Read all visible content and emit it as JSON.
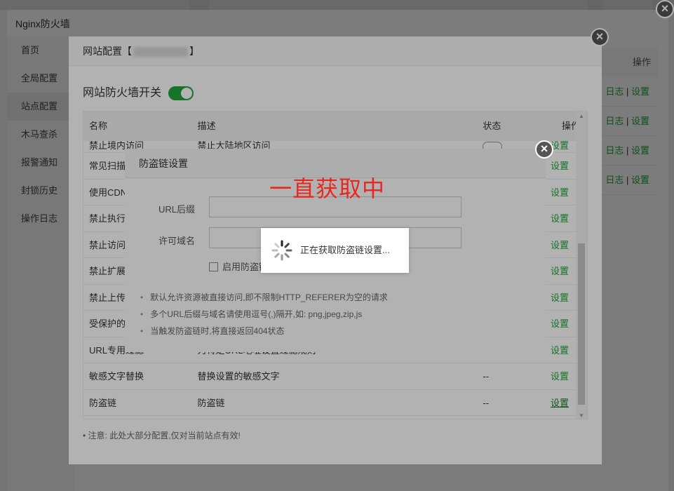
{
  "app": {
    "window_title": "Nginx防火墙"
  },
  "sidebar": {
    "items": [
      {
        "label": "首页"
      },
      {
        "label": "全局配置"
      },
      {
        "label": "站点配置"
      },
      {
        "label": "木马查杀"
      },
      {
        "label": "报警通知"
      },
      {
        "label": "封锁历史"
      },
      {
        "label": "操作日志"
      }
    ]
  },
  "bg_table": {
    "header": "操作",
    "row_links": {
      "log": "日志",
      "sep": "|",
      "set": "设置"
    }
  },
  "site_modal": {
    "title_prefix": "网站配置【",
    "title_suffix": "】",
    "toggle_label": "网站防火墙开关",
    "toggle_on": true,
    "columns": {
      "name": "名称",
      "desc": "描述",
      "status": "状态",
      "op": "操作"
    },
    "rows": [
      {
        "name": "禁止境内访问",
        "desc": "禁止大陆地区访问",
        "status": "",
        "op": "设置"
      },
      {
        "name": "常见扫描",
        "desc": "",
        "status": "",
        "op": "设置"
      },
      {
        "name": "使用CDN",
        "desc": "",
        "status": "",
        "op": "设置"
      },
      {
        "name": "禁止执行",
        "desc": "",
        "status": "",
        "op": "设置"
      },
      {
        "name": "禁止访问",
        "desc": "",
        "status": "",
        "op": "设置"
      },
      {
        "name": "禁止扩展",
        "desc": "",
        "status": "",
        "op": "设置"
      },
      {
        "name": "禁止上传",
        "desc": "",
        "status": "",
        "op": "设置"
      },
      {
        "name": "受保护的",
        "desc": "",
        "status": "",
        "op": "设置"
      },
      {
        "name": "URL专用过滤",
        "desc": "为特定URL地址设置过滤规则",
        "status": "--",
        "op": "设置"
      },
      {
        "name": "敏感文字替换",
        "desc": "替换设置的敏感文字",
        "status": "--",
        "op": "设置"
      },
      {
        "name": "防盗链",
        "desc": "防盗链",
        "status": "--",
        "op": "设置"
      }
    ],
    "note": "注意: 此处大部分配置,仅对当前站点有效!"
  },
  "leech_dialog": {
    "title": "防盗链设置",
    "url_suffix_label": "URL后缀",
    "url_suffix_value": "",
    "allowed_domain_label": "许可域名",
    "allowed_domain_value": "",
    "enable_label": "启用防盗链",
    "tips": [
      "默认允许资源被直接访问,即不限制HTTP_REFERER为空的请求",
      "多个URL后缀与域名请使用逗号(,)隔开,如: png,jpeg,zip,js",
      "当触发防盗链时,将直接返回404状态"
    ]
  },
  "annotation": "一直获取中",
  "loading": {
    "text": "正在获取防盗链设置..."
  },
  "colors": {
    "accent": "#20a53a",
    "annotation": "#e8281e"
  }
}
